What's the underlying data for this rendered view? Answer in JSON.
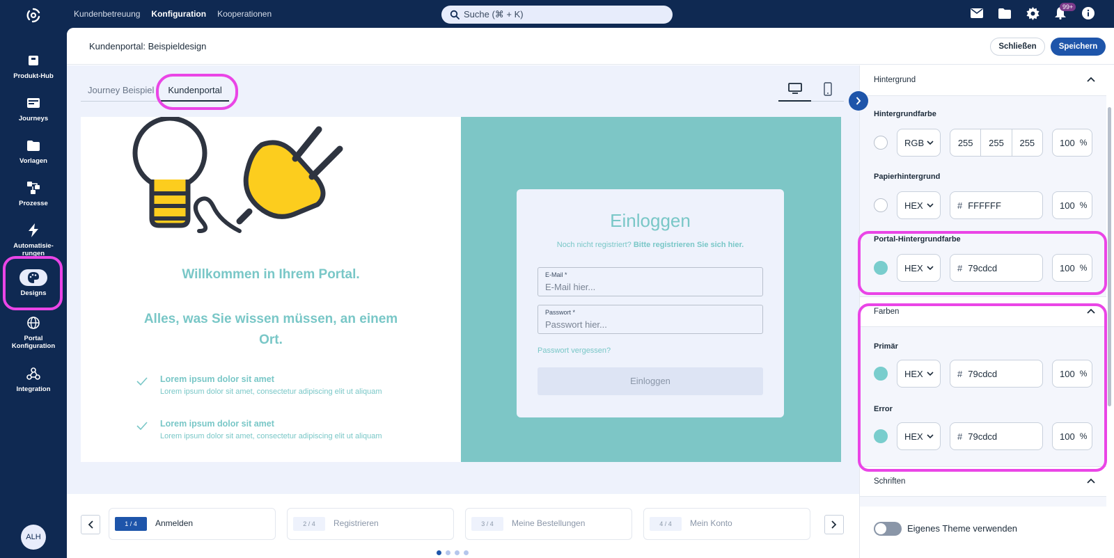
{
  "topbar": {
    "nav": [
      "Kundenbetreuung",
      "Konfiguration",
      "Kooperationen"
    ],
    "active_nav": "Konfiguration",
    "search_placeholder": "Suche (⌘ + K)",
    "notification_badge": "99+",
    "icons": [
      "mail-icon",
      "folder-icon",
      "gear-icon",
      "bell-icon",
      "info-icon"
    ]
  },
  "sidebar": {
    "items": [
      {
        "label": "Produkt-Hub",
        "icon": "box-icon"
      },
      {
        "label": "Journeys",
        "icon": "card-icon"
      },
      {
        "label": "Vorlagen",
        "icon": "folder-icon"
      },
      {
        "label": "Prozesse",
        "icon": "flow-icon"
      },
      {
        "label": "Automatisie-rungen",
        "icon": "bolt-icon"
      },
      {
        "label": "Designs",
        "icon": "palette-icon",
        "active": true
      },
      {
        "label": "Portal Konfiguration",
        "icon": "globe-icon"
      },
      {
        "label": "Integration",
        "icon": "webhook-icon"
      }
    ],
    "avatar": "ALH"
  },
  "header": {
    "title": "Kundenportal: Beispieldesign",
    "close_label": "Schließen",
    "save_label": "Speichern"
  },
  "tabs": [
    {
      "label": "Journey Beispiel",
      "active": false
    },
    {
      "label": "Kundenportal",
      "active": true
    }
  ],
  "preview": {
    "welcome_1": "Willkommen in Ihrem Portal.",
    "welcome_2": "Alles, was Sie wissen müssen, an einem Ort.",
    "features": [
      {
        "title": "Lorem ipsum dolor sit amet",
        "sub": "Lorem ipsum dolor sit amet, consectetur adipiscing elit ut aliquam"
      },
      {
        "title": "Lorem ipsum dolor sit amet",
        "sub": "Lorem ipsum dolor sit amet, consectetur adipiscing elit ut aliquam"
      }
    ],
    "login": {
      "title": "Einloggen",
      "sub_prefix": "Noch nicht registriert?",
      "sub_link": "Bitte registrieren Sie sich hier.",
      "email_label": "E-Mail *",
      "email_placeholder": "E-Mail hier...",
      "password_label": "Passwort *",
      "password_placeholder": "Passwort hier...",
      "forgot": "Passwort vergessen?",
      "button": "Einloggen"
    },
    "background_color": "#79cdcd"
  },
  "steps": [
    {
      "num": "1 / 4",
      "label": "Anmelden",
      "active": true
    },
    {
      "num": "2 / 4",
      "label": "Registrieren",
      "active": false
    },
    {
      "num": "3 / 4",
      "label": "Meine Bestellungen",
      "active": false
    },
    {
      "num": "4 / 4",
      "label": "Mein Konto",
      "active": false
    }
  ],
  "panel": {
    "hintergrund": {
      "title": "Hintergrund",
      "hintergrundfarbe": {
        "label": "Hintergrundfarbe",
        "format": "RGB",
        "r": "255",
        "g": "255",
        "b": "255",
        "opacity": "100",
        "unit": "%"
      },
      "papier": {
        "label": "Papierhintergrund",
        "format": "HEX",
        "hash": "#",
        "hex": "FFFFFF",
        "opacity": "100",
        "unit": "%"
      },
      "portal": {
        "label": "Portal-Hintergrundfarbe",
        "format": "HEX",
        "hash": "#",
        "hex": "79cdcd",
        "opacity": "100",
        "unit": "%"
      }
    },
    "farben": {
      "title": "Farben",
      "primaer": {
        "label": "Primär",
        "format": "HEX",
        "hash": "#",
        "hex": "79cdcd",
        "opacity": "100",
        "unit": "%"
      },
      "error": {
        "label": "Error",
        "format": "HEX",
        "hash": "#",
        "hex": "79cdcd",
        "opacity": "100",
        "unit": "%"
      }
    },
    "schriften": {
      "title": "Schriften"
    },
    "own_theme_label": "Eigenes Theme verwenden",
    "own_theme_enabled": false
  },
  "colors": {
    "nav_bg": "#0f2952",
    "accent": "#1e55aa",
    "teal": "#79cdcd",
    "highlight": "#ea45e6"
  }
}
